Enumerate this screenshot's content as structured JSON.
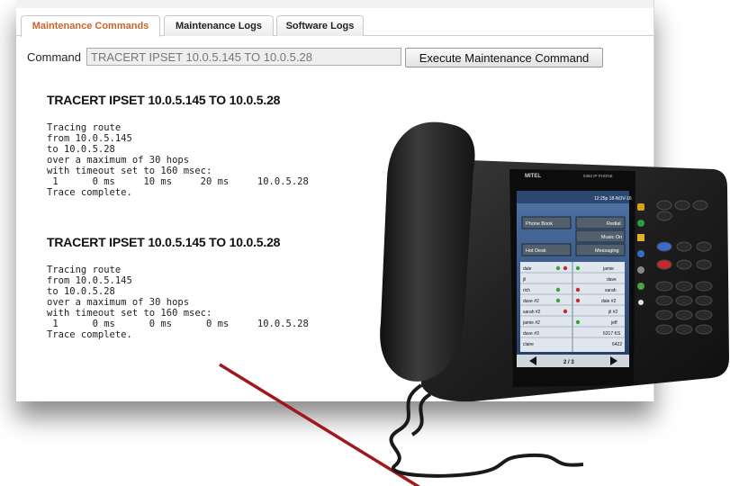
{
  "tabs": [
    {
      "label": "Maintenance Commands",
      "active": true
    },
    {
      "label": "Maintenance Logs",
      "active": false
    },
    {
      "label": "Software Logs",
      "active": false
    }
  ],
  "command": {
    "label": "Command",
    "value": "TRACERT IPSET 10.0.5.145 TO 10.0.5.28",
    "execute_label": "Execute Maintenance Command"
  },
  "results": [
    {
      "title": "TRACERT IPSET 10.0.5.145 TO 10.0.5.28",
      "output": "Tracing route\nfrom 10.0.5.145\nto 10.0.5.28\nover a maximum of 30 hops\nwith timeout set to 160 msec:\n 1      0 ms     10 ms     20 ms     10.0.5.28\nTrace complete."
    },
    {
      "title": "TRACERT IPSET 10.0.5.145 TO 10.0.5.28",
      "output": "Tracing route\nfrom 10.0.5.145\nto 10.0.5.28\nover a maximum of 30 hops\nwith timeout set to 160 msec:\n 1      0 ms      0 ms      0 ms     10.0.5.28\nTrace complete."
    }
  ],
  "phone": {
    "brand": "MITEL",
    "model": "5360 IP PHONE",
    "clock": "12:25p 18-NOV-16",
    "softkeys": [
      {
        "left": "Phone Book",
        "right": "Redial"
      },
      {
        "left": "",
        "right": "Music On"
      },
      {
        "left": "Hot Desk",
        "right": "Messaging"
      }
    ],
    "contacts": [
      {
        "left": "dale",
        "right": "jamie"
      },
      {
        "left": "jil",
        "right": "dave"
      },
      {
        "left": "rich",
        "right": "sarah"
      },
      {
        "left": "dave #2",
        "right": "dale #2"
      },
      {
        "left": "sarah #2",
        "right": "jil #2"
      },
      {
        "left": "jamie #2",
        "right": "jeff"
      },
      {
        "left": "dave #3",
        "right": "6317 KS"
      },
      {
        "left": "claire",
        "right": "6422"
      }
    ],
    "page_indicator": "2 / 3",
    "body_color": "#1f1f1f",
    "screen_color": "#3f5f8a"
  },
  "colors": {
    "active_tab": "#c8642a",
    "annotation_arrow": "#a0181e"
  }
}
